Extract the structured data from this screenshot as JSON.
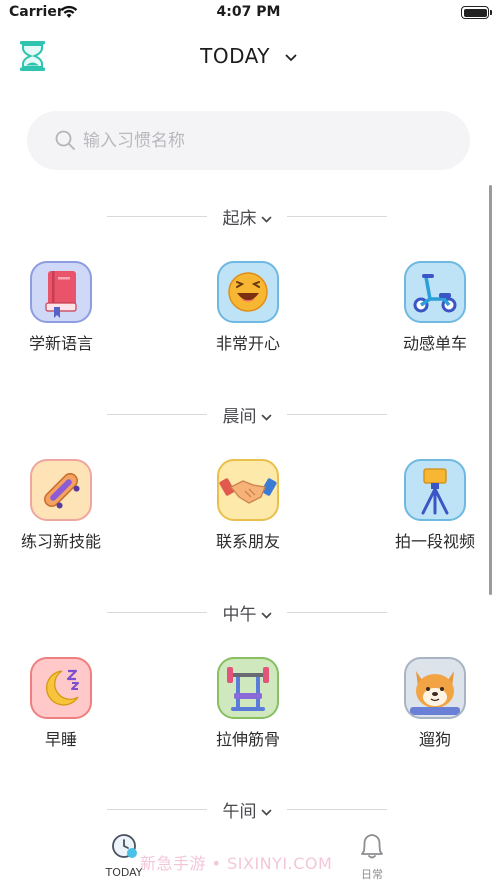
{
  "status_bar": {
    "carrier": "Carrier",
    "time": "4:07 PM"
  },
  "nav": {
    "title": "TODAY",
    "hourglass_icon": "hourglass-icon",
    "dropdown_icon": "chevron-down-icon"
  },
  "search": {
    "placeholder": "输入习惯名称",
    "value": ""
  },
  "sections": [
    {
      "label": "起床",
      "habits": [
        {
          "name": "学新语言",
          "icon": "book-icon",
          "tile_color": "#cfd8f7",
          "border_color": "#8e9ce0"
        },
        {
          "name": "非常开心",
          "icon": "laughing-face-icon",
          "tile_color": "#bfe3f6",
          "border_color": "#6fb8e0"
        },
        {
          "name": "动感单车",
          "icon": "scooter-icon",
          "tile_color": "#bfe3f6",
          "border_color": "#6fb8e0"
        }
      ]
    },
    {
      "label": "晨间",
      "habits": [
        {
          "name": "练习新技能",
          "icon": "skateboard-icon",
          "tile_color": "#fde3b5",
          "border_color": "#f0a6a0"
        },
        {
          "name": "联系朋友",
          "icon": "handshake-icon",
          "tile_color": "#fde9a9",
          "border_color": "#e9c04c"
        },
        {
          "name": "拍一段视频",
          "icon": "camera-tripod-icon",
          "tile_color": "#bfe3f6",
          "border_color": "#6fb8e0"
        }
      ]
    },
    {
      "label": "中午",
      "habits": [
        {
          "name": "早睡",
          "icon": "moon-sleep-icon",
          "tile_color": "#ffc9c9",
          "border_color": "#ef7f7f"
        },
        {
          "name": "拉伸筋骨",
          "icon": "weight-bench-icon",
          "tile_color": "#cfe8bd",
          "border_color": "#88bf63"
        },
        {
          "name": "遛狗",
          "icon": "dog-icon",
          "tile_color": "#dde3ea",
          "border_color": "#a9b4c2"
        }
      ]
    },
    {
      "label": "午间",
      "habits": []
    }
  ],
  "tabbar": {
    "today": {
      "label": "TODAY",
      "icon": "clock-face-icon"
    },
    "daily": {
      "label": "日常",
      "icon": "bell-icon"
    }
  },
  "watermark": "新急手游 • SIXINYI.COM"
}
